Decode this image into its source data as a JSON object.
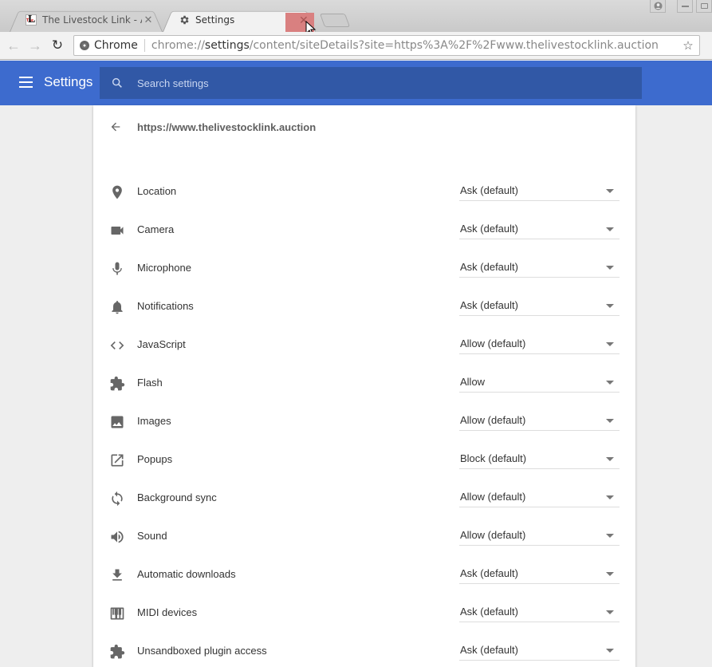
{
  "browser": {
    "tabs": [
      {
        "title": "The Livestock Link - Auc",
        "favicon": "livestock-link-logo",
        "active": false
      },
      {
        "title": "Settings",
        "favicon": "gear-icon",
        "active": true
      }
    ],
    "tab_close_glyph": "✕",
    "window_buttons": [
      "profile-icon",
      "minimize-icon",
      "maximize-icon"
    ],
    "toolbar": {
      "back_glyph": "←",
      "forward_glyph": "→",
      "reload_glyph": "↻",
      "chip_label": "Chrome",
      "url_prefix": "chrome://",
      "url_host": "settings",
      "url_path": "/content/siteDetails?site=https%3A%2F%2Fwww.thelivestocklink.auction",
      "bookmark_glyph": "☆"
    }
  },
  "header": {
    "title": "Settings",
    "search_placeholder": "Search settings"
  },
  "site": {
    "title": "https://www.thelivestocklink.auction"
  },
  "permissions": [
    {
      "label": "Location",
      "icon": "location-pin-icon",
      "value": "Ask (default)"
    },
    {
      "label": "Camera",
      "icon": "camera-icon",
      "value": "Ask (default)"
    },
    {
      "label": "Microphone",
      "icon": "microphone-icon",
      "value": "Ask (default)"
    },
    {
      "label": "Notifications",
      "icon": "bell-icon",
      "value": "Ask (default)"
    },
    {
      "label": "JavaScript",
      "icon": "code-icon",
      "value": "Allow (default)"
    },
    {
      "label": "Flash",
      "icon": "puzzle-piece-icon",
      "value": "Allow"
    },
    {
      "label": "Images",
      "icon": "image-icon",
      "value": "Allow (default)"
    },
    {
      "label": "Popups",
      "icon": "open-in-new-icon",
      "value": "Block (default)"
    },
    {
      "label": "Background sync",
      "icon": "sync-icon",
      "value": "Allow (default)"
    },
    {
      "label": "Sound",
      "icon": "speaker-icon",
      "value": "Allow (default)"
    },
    {
      "label": "Automatic downloads",
      "icon": "download-icon",
      "value": "Ask (default)"
    },
    {
      "label": "MIDI devices",
      "icon": "piano-keys-icon",
      "value": "Ask (default)"
    },
    {
      "label": "Unsandboxed plugin access",
      "icon": "puzzle-piece-icon",
      "value": "Ask (default)"
    }
  ]
}
